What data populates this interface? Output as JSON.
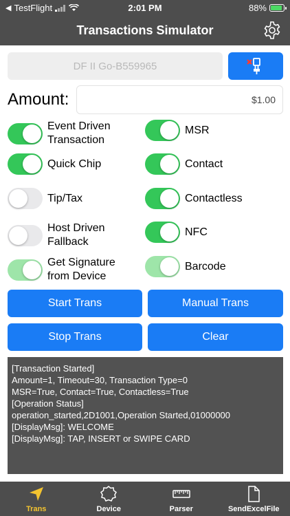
{
  "status_bar": {
    "carrier": "TestFlight",
    "time": "2:01 PM",
    "battery": "88%"
  },
  "nav": {
    "title": "Transactions Simulator"
  },
  "device": {
    "placeholder": "DF II Go-B559965"
  },
  "amount": {
    "label": "Amount:",
    "value": "$1.00"
  },
  "toggles": [
    {
      "label": "Event Driven\nTransaction",
      "on": true,
      "faded": false
    },
    {
      "label": "MSR",
      "on": true,
      "faded": false
    },
    {
      "label": "Quick Chip",
      "on": true,
      "faded": false
    },
    {
      "label": "Contact",
      "on": true,
      "faded": false
    },
    {
      "label": "Tip/Tax",
      "on": false,
      "faded": false
    },
    {
      "label": "Contactless",
      "on": true,
      "faded": false
    },
    {
      "label": "Host Driven\nFallback",
      "on": false,
      "faded": false
    },
    {
      "label": "NFC",
      "on": true,
      "faded": false
    },
    {
      "label": "Get Signature\nfrom Device",
      "on": true,
      "faded": true
    },
    {
      "label": "Barcode",
      "on": true,
      "faded": true
    }
  ],
  "buttons": {
    "start": "Start Trans",
    "manual": "Manual Trans",
    "stop": "Stop Trans",
    "clear": "Clear"
  },
  "log_lines": [
    "[Transaction Started]",
    "Amount=1, Timeout=30, Transaction Type=0",
    "MSR=True, Contact=True, Contactless=True",
    "[Operation Status]",
    "operation_started,2D1001,Operation Started,01000000",
    "[DisplayMsg]: WELCOME",
    "[DisplayMsg]: TAP, INSERT or SWIPE CARD"
  ],
  "tabs": [
    {
      "label": "Trans",
      "icon": "paper-plane-icon",
      "active": true
    },
    {
      "label": "Device",
      "icon": "badge-gear-icon",
      "active": false
    },
    {
      "label": "Parser",
      "icon": "ruler-icon",
      "active": false
    },
    {
      "label": "SendExcelFile",
      "icon": "document-icon",
      "active": false
    }
  ],
  "colors": {
    "bar": "#4d4d4d",
    "accent": "#1a7cf5",
    "switch_on": "#34c759",
    "active_tab": "#f4c430"
  }
}
